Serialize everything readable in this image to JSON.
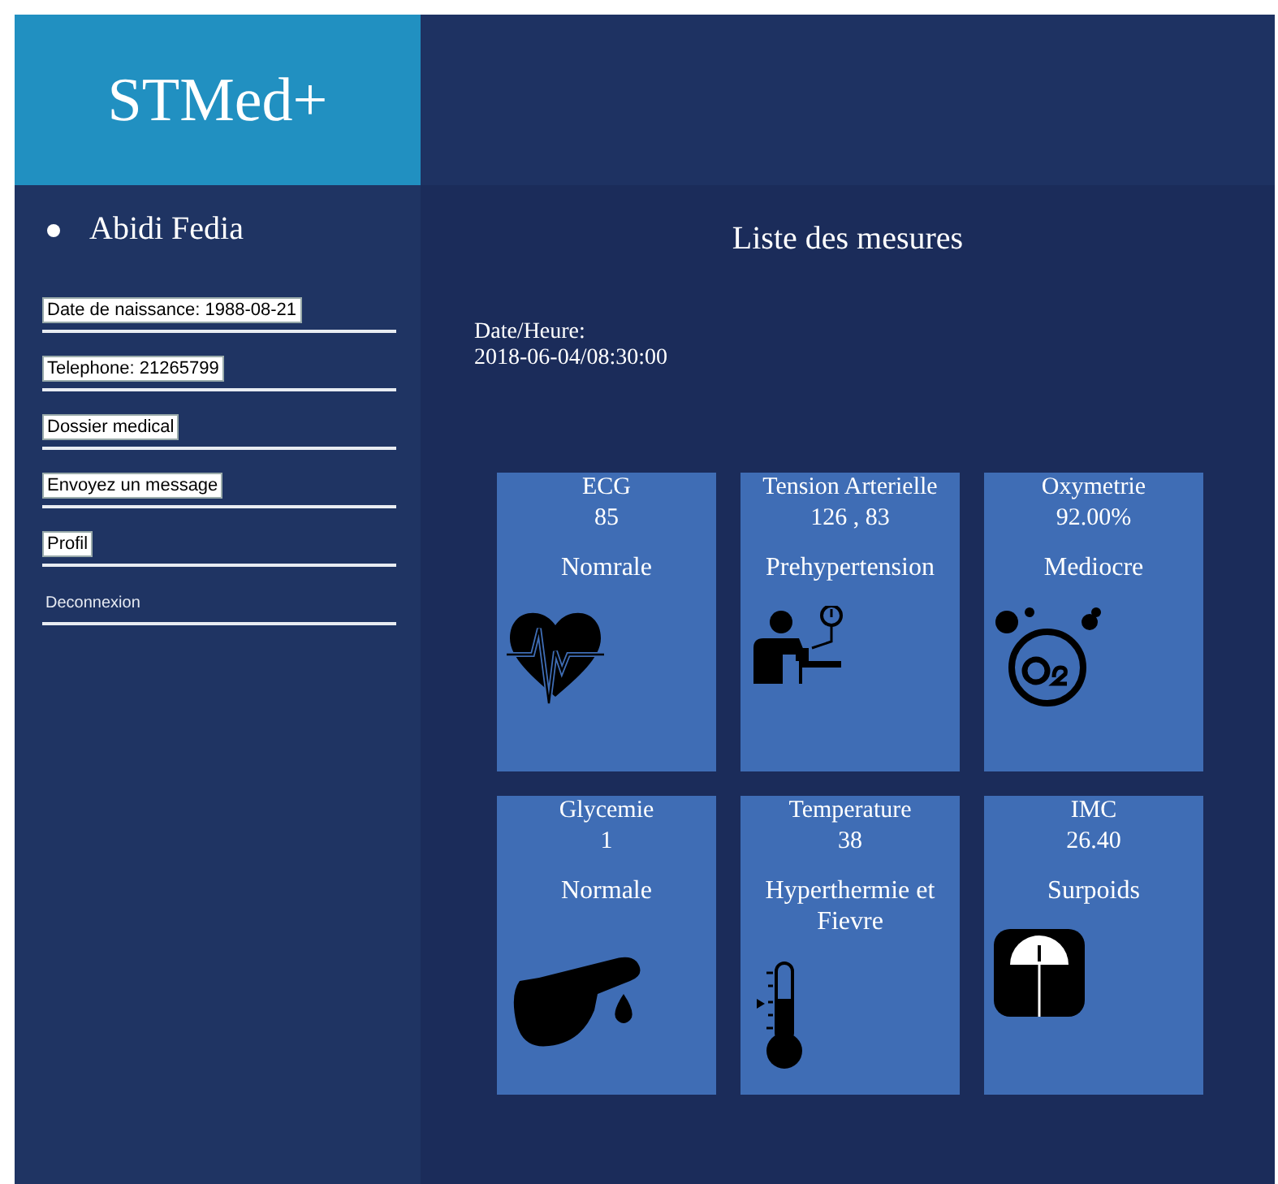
{
  "logo": "STMed+",
  "patient": {
    "name": "Abidi Fedia"
  },
  "menu": [
    {
      "kind": "box",
      "label": "Date de naissance: 1988-08-21"
    },
    {
      "kind": "box",
      "label": "Telephone: 21265799"
    },
    {
      "kind": "box",
      "label": "Dossier medical"
    },
    {
      "kind": "box",
      "label": "Envoyez un message"
    },
    {
      "kind": "box",
      "label": "Profil"
    },
    {
      "kind": "link",
      "label": "Deconnexion"
    }
  ],
  "main": {
    "title": "Liste des mesures",
    "datetime_label": "Date/Heure:",
    "datetime": "2018-06-04/08:30:00"
  },
  "measures": [
    {
      "name": "ECG",
      "value": "85",
      "status": "Nomrale"
    },
    {
      "name": "Tension Arterielle",
      "value": "126 , 83",
      "status": "Prehypertension"
    },
    {
      "name": "Oxymetrie",
      "value": "92.00%",
      "status": "Mediocre"
    },
    {
      "name": "Glycemie",
      "value": "1",
      "status": "Normale"
    },
    {
      "name": "Temperature",
      "value": "38",
      "status": "Hyperthermie et Fievre"
    },
    {
      "name": "IMC",
      "value": "26.40",
      "status": "Surpoids"
    }
  ]
}
